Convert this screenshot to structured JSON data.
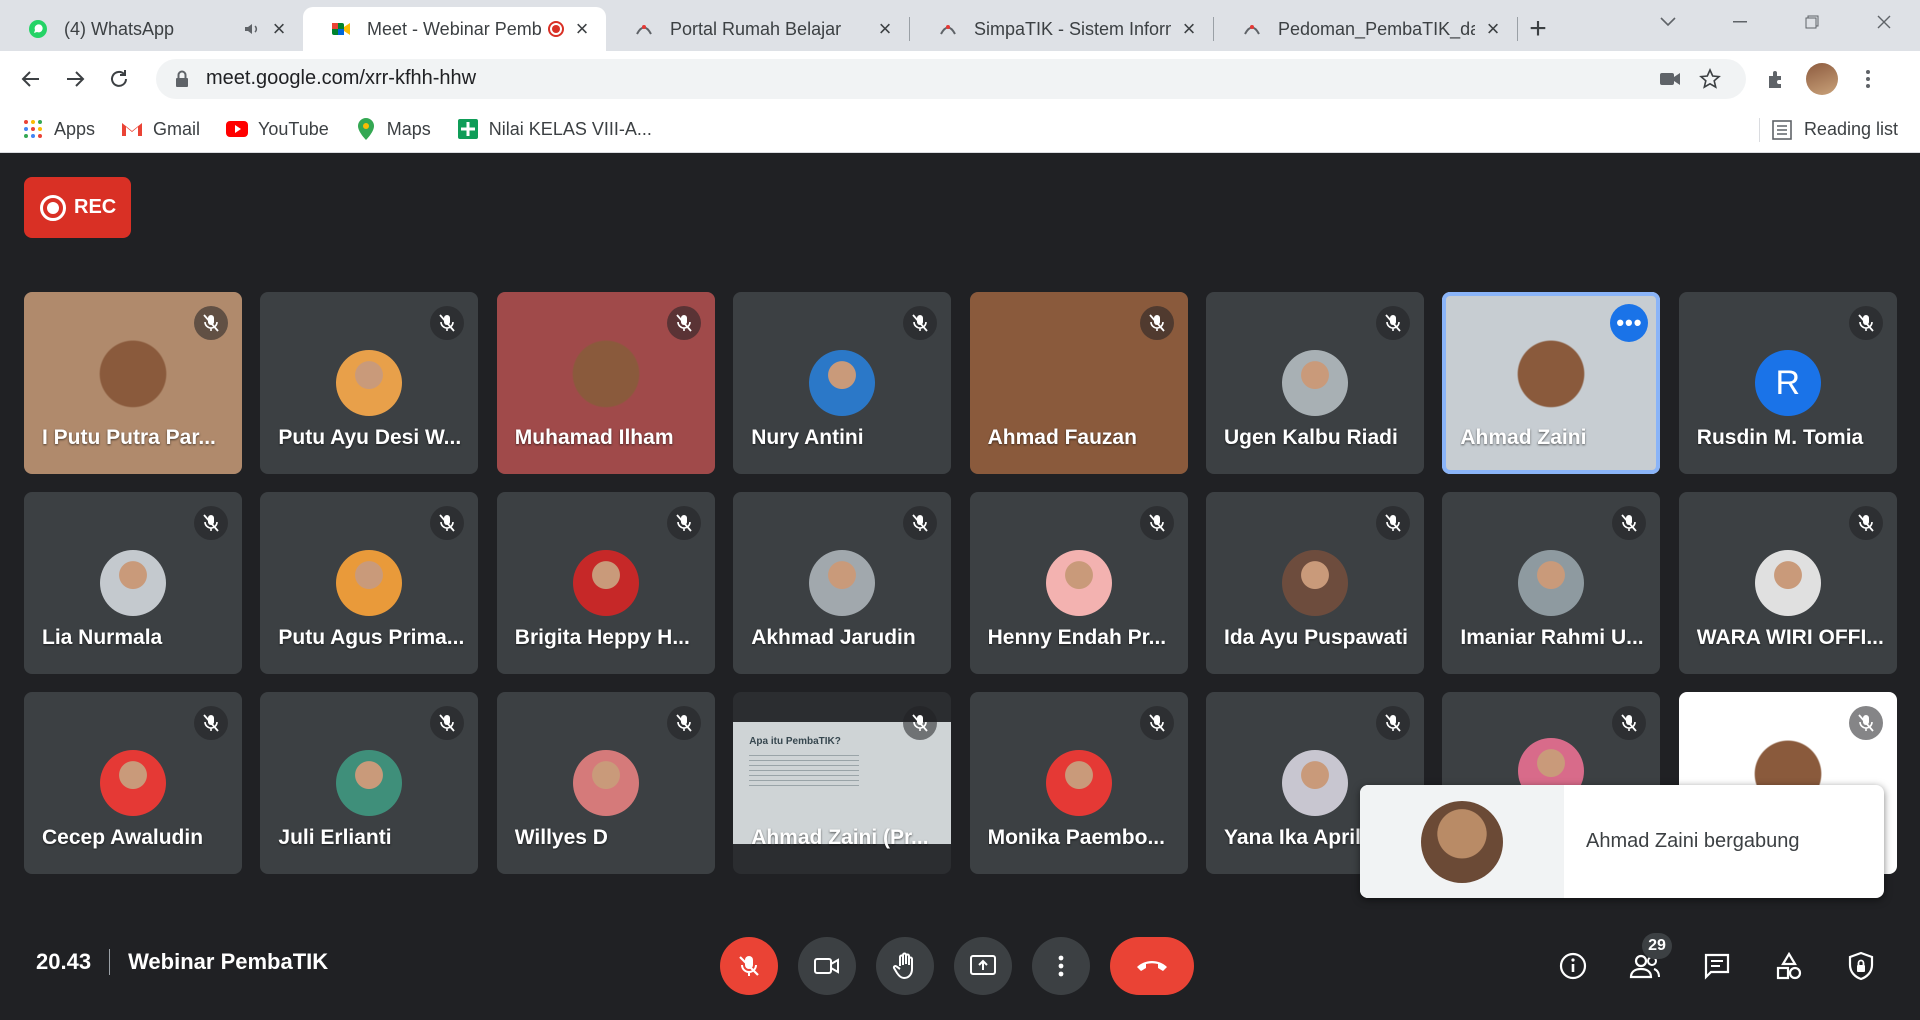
{
  "browser": {
    "tabs": [
      {
        "title": "(4) WhatsApp",
        "active": false
      },
      {
        "title": "Meet - Webinar PembaTIK",
        "active": true
      },
      {
        "title": "Portal Rumah Belajar",
        "active": false
      },
      {
        "title": "SimpaTIK - Sistem Informasi",
        "active": false
      },
      {
        "title": "Pedoman_PembaTIK_dan_",
        "active": false
      }
    ],
    "url": "meet.google.com/xrr-kfhh-hhw",
    "bookmarks": [
      "Apps",
      "Gmail",
      "YouTube",
      "Maps",
      "Nilai KELAS VIII-A..."
    ],
    "reading_list": "Reading list"
  },
  "meet": {
    "rec_label": "REC",
    "participants": [
      {
        "name": "I Putu Putra Par...",
        "type": "video",
        "color": "#b08a6c"
      },
      {
        "name": "Putu Ayu Desi W...",
        "type": "avatar",
        "color": "#e8a04a"
      },
      {
        "name": "Muhamad Ilham",
        "type": "video",
        "color": "#a04a4a"
      },
      {
        "name": "Nury Antini",
        "type": "avatar",
        "color": "#2b78c8"
      },
      {
        "name": "Ahmad Fauzan",
        "type": "video",
        "color": "#8a5a3c"
      },
      {
        "name": "Ugen Kalbu Riadi",
        "type": "avatar",
        "color": "#a8b0b4"
      },
      {
        "name": "Ahmad Zaini",
        "type": "video",
        "color": "#c7cdd2",
        "active": true
      },
      {
        "name": "Rusdin M. Tomia",
        "type": "letter",
        "color": "#1a73e8",
        "letter": "R"
      },
      {
        "name": "Lia Nurmala",
        "type": "avatar",
        "color": "#c4c9ce"
      },
      {
        "name": "Putu Agus Prima...",
        "type": "avatar",
        "color": "#e99a3a"
      },
      {
        "name": "Brigita Heppy H...",
        "type": "avatar",
        "color": "#c62828"
      },
      {
        "name": "Akhmad Jarudin",
        "type": "avatar",
        "color": "#a1a8ad"
      },
      {
        "name": "Henny Endah Pr...",
        "type": "avatar",
        "color": "#f3b2b0"
      },
      {
        "name": "Ida Ayu Puspawati",
        "type": "avatar",
        "color": "#6d4c3d"
      },
      {
        "name": "Imaniar Rahmi U...",
        "type": "avatar",
        "color": "#8e9aa0"
      },
      {
        "name": "WARA WIRI OFFI...",
        "type": "avatar",
        "color": "#e0e0e0"
      },
      {
        "name": "Cecep Awaludin",
        "type": "avatar",
        "color": "#e53935"
      },
      {
        "name": "Juli Erlianti",
        "type": "avatar",
        "color": "#3f8f7a"
      },
      {
        "name": "Willyes D",
        "type": "avatar",
        "color": "#d57a7a"
      },
      {
        "name": "Ahmad Zaini (Pr...",
        "type": "screen",
        "color": "#cfd4d6",
        "slide_title": "Apa itu PembaTIK?"
      },
      {
        "name": "Monika Paembo...",
        "type": "avatar",
        "color": "#e53935"
      },
      {
        "name": "Yana Ika April",
        "type": "avatar",
        "color": "#c8c6d0"
      },
      {
        "name": "",
        "type": "avatar",
        "color": "#d86b8a"
      },
      {
        "name": "",
        "type": "video",
        "color": "#ffffff"
      }
    ],
    "toast": {
      "message": "Ahmad Zaini bergabung"
    },
    "time": "20.43",
    "meeting_title": "Webinar PembaTIK",
    "participant_count": "29"
  }
}
